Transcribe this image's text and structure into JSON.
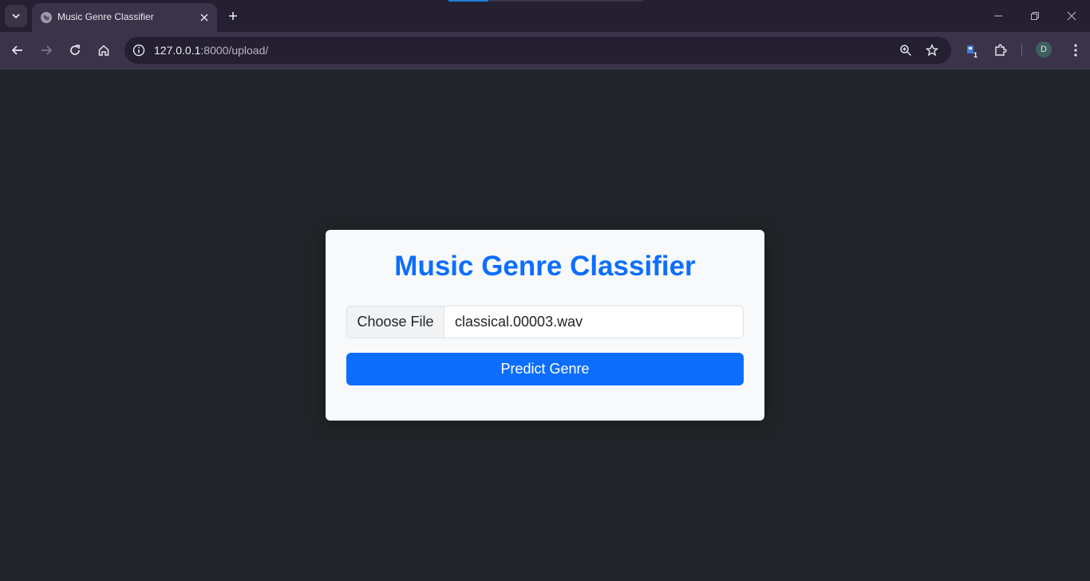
{
  "browser": {
    "tab": {
      "title": "Music Genre Classifier"
    },
    "url": {
      "host": "127.0.0.1",
      "path": ":8000/upload/"
    },
    "profile_initial": "D",
    "extension_badge": "1"
  },
  "app": {
    "title": "Music Genre Classifier",
    "file_input": {
      "button_label": "Choose File",
      "file_name": "classical.00003.wav"
    },
    "submit_label": "Predict Genre"
  },
  "colors": {
    "page_bg": "#212529",
    "card_bg": "#f8f9fa",
    "accent": "#0d6efd"
  },
  "icons": {
    "tab_search": "chevron-down-icon",
    "favicon": "globe-icon",
    "tab_close": "close-icon",
    "new_tab": "plus-icon",
    "back": "arrow-left-icon",
    "forward": "arrow-right-icon",
    "reload": "reload-icon",
    "home": "home-icon",
    "site_info": "info-icon",
    "zoom": "zoom-icon",
    "bookmark": "star-icon",
    "extension": "extension-icon",
    "extensions_menu": "puzzle-icon",
    "menu": "kebab-menu-icon"
  }
}
